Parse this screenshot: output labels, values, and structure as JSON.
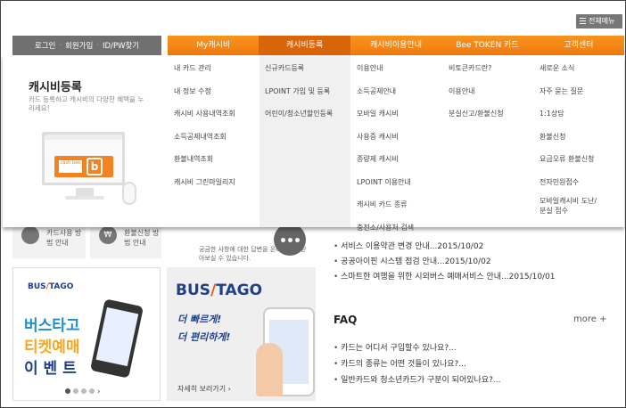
{
  "header": {
    "all_menu_label": "전체메뉴",
    "login_links": [
      "로그인",
      "회원가입",
      "ID/PW찾기"
    ]
  },
  "nav": {
    "tabs": [
      "My캐시비",
      "캐시비등록",
      "캐시비이용안내",
      "Bee TOKEN 카드",
      "고객센터"
    ],
    "active_index": 1
  },
  "dropdown": {
    "promo_title": "캐시비등록",
    "promo_desc": "카드 등록하고 캐시비의 다양한 혜택을 누리세요!",
    "card_label": "cash bee",
    "card_letter": "b",
    "columns": [
      [
        "내 카드 관리",
        "내 정보 수정",
        "캐시비 사용내역조회",
        "소득공제내역조회",
        "환불내역조회",
        "캐시비 그린마일리지"
      ],
      [
        "신규카드등록",
        "LPOINT 가입 및 등록",
        "어린이/청소년할인등록"
      ],
      [
        "이용안내",
        "소득공제안내",
        "모바일 캐시비",
        "사용증 캐시비",
        "종량제 캐시비",
        "LPOINT 이용안내",
        "캐시비 카드 종류",
        "충전소/사용처 검색"
      ],
      [
        "비토큰카드란?",
        "이용안내",
        "분실신고/환불신청"
      ],
      [
        "새로운 소식",
        "자주 묻는 질문",
        "1:1상담",
        "환불신청",
        "요금오류 환불신청",
        "전자민원접수",
        "모바일캐시비 도난/분실 접수"
      ]
    ]
  },
  "quick": [
    {
      "label": "카드사용 방법 안내",
      "icon": "document-icon"
    },
    {
      "label": "환불신청 방법 안내",
      "icon": "won-icon",
      "symbol": "₩"
    }
  ],
  "counsel_text": "궁금한 사항에 대한 답변을 온라인으로 받아보실 수 있습니다.",
  "notices": [
    "서비스 이용약관 변경 안내...2015/10/02",
    "공공아이핀 시스템 점검 안내...2015/10/02",
    "스마트한 여행을 위한 시외버스 예매서비스 안내...2015/10/01"
  ],
  "faq": {
    "title": "FAQ",
    "more": "more +",
    "items": [
      "카드는 어디서 구입할수 있나요?...",
      "카드의 종류는 어떤 것들이 있나요?...",
      "일반카드와 청소년카드가 구분이 되어있나요?..."
    ]
  },
  "banner1": {
    "logo_a": "BUS",
    "logo_b": "TAGO",
    "lines": [
      "버스타고",
      "티켓예매",
      "이 벤 트"
    ],
    "line_colors": [
      "#1b8fd0",
      "#f5a623",
      "#1f3f8a"
    ],
    "next_arrow": "›"
  },
  "banner2": {
    "logo_a": "BUS",
    "logo_b": "TAGO",
    "slogan1": "더 빠르게!",
    "slogan2": "더 편리하게!",
    "more": "자세히 보러가기 ›"
  },
  "colors": {
    "accent": "#f58220",
    "nav_active": "#d9650a",
    "brand_blue": "#1f3f8a"
  }
}
